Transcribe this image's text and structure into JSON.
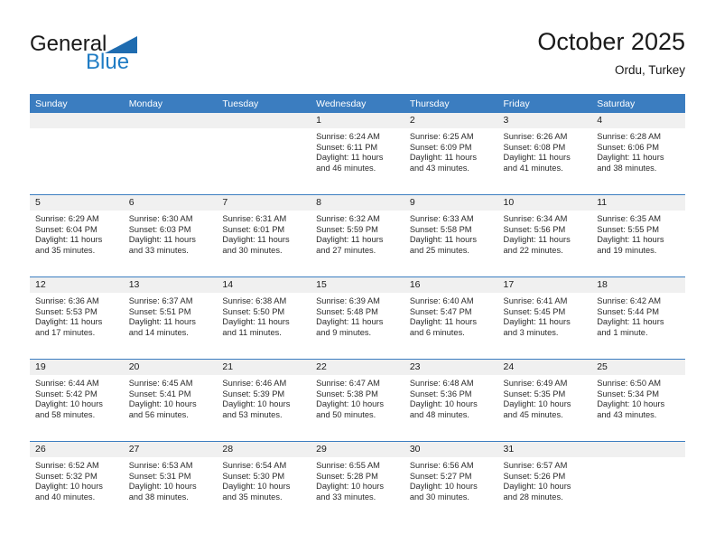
{
  "branding": {
    "name_line1": "General",
    "name_line2": "Blue",
    "accent_color": "#1f7cc4",
    "triangle_color": "#1f6cb0"
  },
  "header": {
    "title": "October 2025",
    "subtitle": "Ordu, Turkey"
  },
  "calendar": {
    "header_bg": "#3b7dc0",
    "daynum_bg": "#f0f0f0",
    "weekday_headers": [
      "Sunday",
      "Monday",
      "Tuesday",
      "Wednesday",
      "Thursday",
      "Friday",
      "Saturday"
    ],
    "weeks": [
      [
        {
          "day": "",
          "sunrise": "",
          "sunset": "",
          "daylight_line1": "",
          "daylight_line2": ""
        },
        {
          "day": "",
          "sunrise": "",
          "sunset": "",
          "daylight_line1": "",
          "daylight_line2": ""
        },
        {
          "day": "",
          "sunrise": "",
          "sunset": "",
          "daylight_line1": "",
          "daylight_line2": ""
        },
        {
          "day": "1",
          "sunrise": "Sunrise: 6:24 AM",
          "sunset": "Sunset: 6:11 PM",
          "daylight_line1": "Daylight: 11 hours",
          "daylight_line2": "and 46 minutes."
        },
        {
          "day": "2",
          "sunrise": "Sunrise: 6:25 AM",
          "sunset": "Sunset: 6:09 PM",
          "daylight_line1": "Daylight: 11 hours",
          "daylight_line2": "and 43 minutes."
        },
        {
          "day": "3",
          "sunrise": "Sunrise: 6:26 AM",
          "sunset": "Sunset: 6:08 PM",
          "daylight_line1": "Daylight: 11 hours",
          "daylight_line2": "and 41 minutes."
        },
        {
          "day": "4",
          "sunrise": "Sunrise: 6:28 AM",
          "sunset": "Sunset: 6:06 PM",
          "daylight_line1": "Daylight: 11 hours",
          "daylight_line2": "and 38 minutes."
        }
      ],
      [
        {
          "day": "5",
          "sunrise": "Sunrise: 6:29 AM",
          "sunset": "Sunset: 6:04 PM",
          "daylight_line1": "Daylight: 11 hours",
          "daylight_line2": "and 35 minutes."
        },
        {
          "day": "6",
          "sunrise": "Sunrise: 6:30 AM",
          "sunset": "Sunset: 6:03 PM",
          "daylight_line1": "Daylight: 11 hours",
          "daylight_line2": "and 33 minutes."
        },
        {
          "day": "7",
          "sunrise": "Sunrise: 6:31 AM",
          "sunset": "Sunset: 6:01 PM",
          "daylight_line1": "Daylight: 11 hours",
          "daylight_line2": "and 30 minutes."
        },
        {
          "day": "8",
          "sunrise": "Sunrise: 6:32 AM",
          "sunset": "Sunset: 5:59 PM",
          "daylight_line1": "Daylight: 11 hours",
          "daylight_line2": "and 27 minutes."
        },
        {
          "day": "9",
          "sunrise": "Sunrise: 6:33 AM",
          "sunset": "Sunset: 5:58 PM",
          "daylight_line1": "Daylight: 11 hours",
          "daylight_line2": "and 25 minutes."
        },
        {
          "day": "10",
          "sunrise": "Sunrise: 6:34 AM",
          "sunset": "Sunset: 5:56 PM",
          "daylight_line1": "Daylight: 11 hours",
          "daylight_line2": "and 22 minutes."
        },
        {
          "day": "11",
          "sunrise": "Sunrise: 6:35 AM",
          "sunset": "Sunset: 5:55 PM",
          "daylight_line1": "Daylight: 11 hours",
          "daylight_line2": "and 19 minutes."
        }
      ],
      [
        {
          "day": "12",
          "sunrise": "Sunrise: 6:36 AM",
          "sunset": "Sunset: 5:53 PM",
          "daylight_line1": "Daylight: 11 hours",
          "daylight_line2": "and 17 minutes."
        },
        {
          "day": "13",
          "sunrise": "Sunrise: 6:37 AM",
          "sunset": "Sunset: 5:51 PM",
          "daylight_line1": "Daylight: 11 hours",
          "daylight_line2": "and 14 minutes."
        },
        {
          "day": "14",
          "sunrise": "Sunrise: 6:38 AM",
          "sunset": "Sunset: 5:50 PM",
          "daylight_line1": "Daylight: 11 hours",
          "daylight_line2": "and 11 minutes."
        },
        {
          "day": "15",
          "sunrise": "Sunrise: 6:39 AM",
          "sunset": "Sunset: 5:48 PM",
          "daylight_line1": "Daylight: 11 hours",
          "daylight_line2": "and 9 minutes."
        },
        {
          "day": "16",
          "sunrise": "Sunrise: 6:40 AM",
          "sunset": "Sunset: 5:47 PM",
          "daylight_line1": "Daylight: 11 hours",
          "daylight_line2": "and 6 minutes."
        },
        {
          "day": "17",
          "sunrise": "Sunrise: 6:41 AM",
          "sunset": "Sunset: 5:45 PM",
          "daylight_line1": "Daylight: 11 hours",
          "daylight_line2": "and 3 minutes."
        },
        {
          "day": "18",
          "sunrise": "Sunrise: 6:42 AM",
          "sunset": "Sunset: 5:44 PM",
          "daylight_line1": "Daylight: 11 hours",
          "daylight_line2": "and 1 minute."
        }
      ],
      [
        {
          "day": "19",
          "sunrise": "Sunrise: 6:44 AM",
          "sunset": "Sunset: 5:42 PM",
          "daylight_line1": "Daylight: 10 hours",
          "daylight_line2": "and 58 minutes."
        },
        {
          "day": "20",
          "sunrise": "Sunrise: 6:45 AM",
          "sunset": "Sunset: 5:41 PM",
          "daylight_line1": "Daylight: 10 hours",
          "daylight_line2": "and 56 minutes."
        },
        {
          "day": "21",
          "sunrise": "Sunrise: 6:46 AM",
          "sunset": "Sunset: 5:39 PM",
          "daylight_line1": "Daylight: 10 hours",
          "daylight_line2": "and 53 minutes."
        },
        {
          "day": "22",
          "sunrise": "Sunrise: 6:47 AM",
          "sunset": "Sunset: 5:38 PM",
          "daylight_line1": "Daylight: 10 hours",
          "daylight_line2": "and 50 minutes."
        },
        {
          "day": "23",
          "sunrise": "Sunrise: 6:48 AM",
          "sunset": "Sunset: 5:36 PM",
          "daylight_line1": "Daylight: 10 hours",
          "daylight_line2": "and 48 minutes."
        },
        {
          "day": "24",
          "sunrise": "Sunrise: 6:49 AM",
          "sunset": "Sunset: 5:35 PM",
          "daylight_line1": "Daylight: 10 hours",
          "daylight_line2": "and 45 minutes."
        },
        {
          "day": "25",
          "sunrise": "Sunrise: 6:50 AM",
          "sunset": "Sunset: 5:34 PM",
          "daylight_line1": "Daylight: 10 hours",
          "daylight_line2": "and 43 minutes."
        }
      ],
      [
        {
          "day": "26",
          "sunrise": "Sunrise: 6:52 AM",
          "sunset": "Sunset: 5:32 PM",
          "daylight_line1": "Daylight: 10 hours",
          "daylight_line2": "and 40 minutes."
        },
        {
          "day": "27",
          "sunrise": "Sunrise: 6:53 AM",
          "sunset": "Sunset: 5:31 PM",
          "daylight_line1": "Daylight: 10 hours",
          "daylight_line2": "and 38 minutes."
        },
        {
          "day": "28",
          "sunrise": "Sunrise: 6:54 AM",
          "sunset": "Sunset: 5:30 PM",
          "daylight_line1": "Daylight: 10 hours",
          "daylight_line2": "and 35 minutes."
        },
        {
          "day": "29",
          "sunrise": "Sunrise: 6:55 AM",
          "sunset": "Sunset: 5:28 PM",
          "daylight_line1": "Daylight: 10 hours",
          "daylight_line2": "and 33 minutes."
        },
        {
          "day": "30",
          "sunrise": "Sunrise: 6:56 AM",
          "sunset": "Sunset: 5:27 PM",
          "daylight_line1": "Daylight: 10 hours",
          "daylight_line2": "and 30 minutes."
        },
        {
          "day": "31",
          "sunrise": "Sunrise: 6:57 AM",
          "sunset": "Sunset: 5:26 PM",
          "daylight_line1": "Daylight: 10 hours",
          "daylight_line2": "and 28 minutes."
        },
        {
          "day": "",
          "sunrise": "",
          "sunset": "",
          "daylight_line1": "",
          "daylight_line2": ""
        }
      ]
    ]
  }
}
